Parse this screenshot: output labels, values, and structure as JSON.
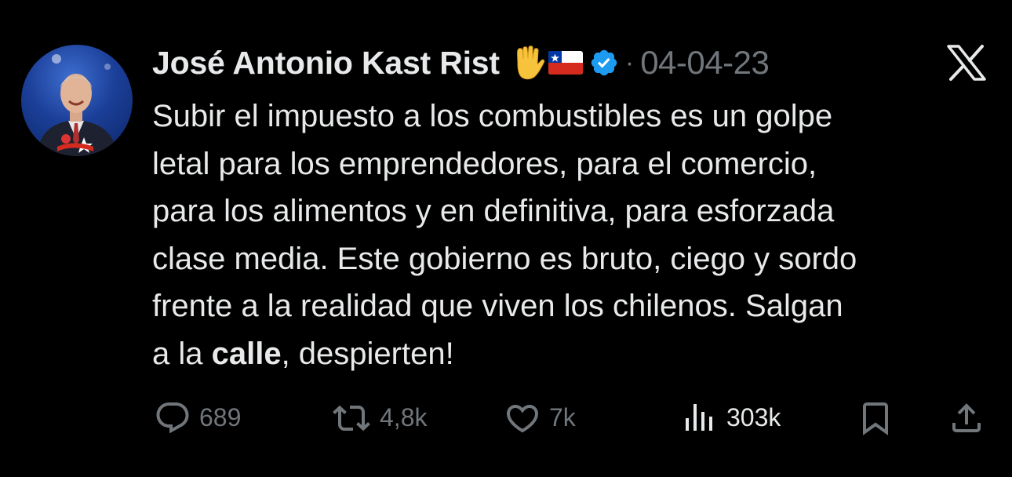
{
  "tweet": {
    "author": "José Antonio Kast Rist",
    "separator": "·",
    "date": "04-04-23",
    "body_lines": [
      "Subir el impuesto a los combustibles es un golpe",
      "letal para los emprendedores, para el comercio,",
      "para los alimentos y en definitiva, para esforzada",
      "clase media. Este gobierno es bruto, ciego y sordo",
      "frente a la realidad que viven los chilenos. Salgan"
    ],
    "last_line": {
      "prefix": "a la ",
      "bold": "calle",
      "suffix": ", despierten!"
    }
  },
  "icons": {
    "hand": "raised-hand-icon",
    "flag": "chile-flag-icon",
    "verified": "verified-badge-icon",
    "logo": "x-logo-icon"
  },
  "actions": {
    "replies": "689",
    "reposts": "4,8k",
    "likes": "7k",
    "views": "303k"
  },
  "colors": {
    "background": "#000000",
    "text": "#e7e9ea",
    "muted": "#71767b",
    "verified": "#1d9bf0"
  }
}
